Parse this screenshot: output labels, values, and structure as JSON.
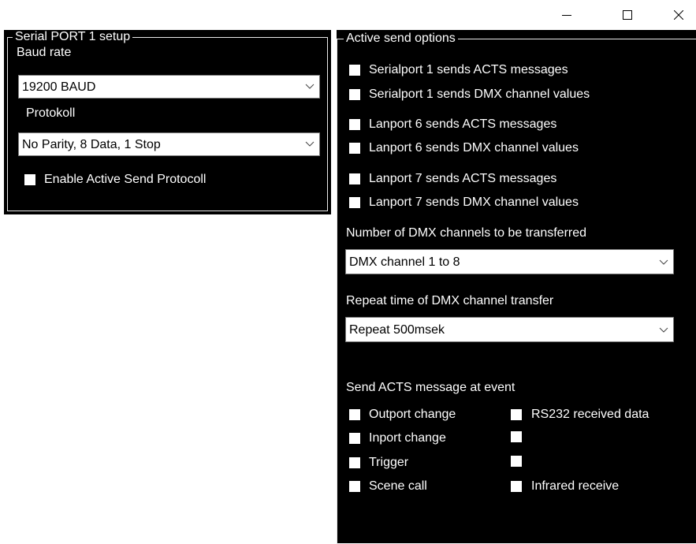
{
  "window_controls": {
    "minimize": "minimize-icon",
    "maximize": "maximize-icon",
    "close": "close-icon"
  },
  "serial_setup": {
    "title": "Serial PORT 1 setup",
    "baud_label": "Baud rate",
    "baud_value": "19200 BAUD",
    "protocol_label": "Protokoll",
    "protocol_value": "No Parity, 8 Data, 1 Stop",
    "enable_label": "Enable Active Send Protocoll"
  },
  "active_send": {
    "title": "Active send options",
    "options": [
      "Serialport 1 sends ACTS messages",
      "Serialport 1 sends DMX channel  values",
      "Lanport 6 sends  ACTS messages",
      "Lanport 6 sends DMX channel  values",
      "Lanport 7 sends  ACTS messages",
      "Lanport 7 sends DMX channel  values"
    ],
    "dmx_count_label": "Number of DMX channels to be transferred",
    "dmx_count_value": "DMX channel 1 to 8",
    "repeat_label": "Repeat time of DMX channel transfer",
    "repeat_value": "Repeat 500msek",
    "event_label": "Send ACTS message at event",
    "events_left": [
      "Outport change",
      "Inport change",
      "Trigger",
      "Scene call"
    ],
    "events_right": [
      "RS232 received data",
      "",
      "",
      "Infrared receive"
    ]
  },
  "colors": {
    "panel_bg": "#000000",
    "text": "#ffffff",
    "combo_bg": "#ffffff"
  }
}
